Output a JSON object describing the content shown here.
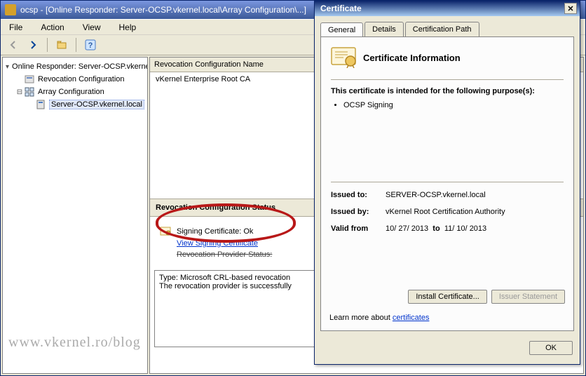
{
  "window": {
    "title": "ocsp - [Online Responder: Server-OCSP.vkernel.local\\Array Configuration\\...]"
  },
  "menubar": {
    "file": "File",
    "action": "Action",
    "view": "View",
    "help": "Help"
  },
  "tree": {
    "root": "Online Responder: Server-OCSP.vkernel",
    "revoc": "Revocation Configuration",
    "array": "Array Configuration",
    "server": "Server-OCSP.vkernel.local"
  },
  "detail": {
    "header": "Revocation Configuration Name",
    "row1": "vKernel Enterprise Root CA",
    "status_header": "Revocation Configuration Status",
    "signing_line": "Signing Certificate: Ok",
    "view_signing": "View Signing Certificate",
    "prov_line": "Revocation Provider Status:",
    "type_line1": "Type: Microsoft CRL-based revocation",
    "type_line2": "The revocation provider is successfully"
  },
  "certdlg": {
    "title": "Certificate",
    "tabs": {
      "general": "General",
      "details": "Details",
      "certpath": "Certification Path"
    },
    "heading": "Certificate Information",
    "purpose_intro": "This certificate is intended for the following purpose(s):",
    "purpose1": "OCSP Signing",
    "issued_to_label": "Issued to:",
    "issued_to": "SERVER-OCSP.vkernel.local",
    "issued_by_label": "Issued by:",
    "issued_by": "vKernel Root Certification Authority",
    "valid_from_label": "Valid from",
    "valid_from": "10/ 27/ 2013",
    "valid_to_word": "to",
    "valid_to": "11/ 10/ 2013",
    "install_btn": "Install Certificate...",
    "issuer_btn": "Issuer Statement",
    "learn_prefix": "Learn more about ",
    "learn_link": "certificates",
    "ok": "OK"
  },
  "watermark": "www.vkernel.ro/blog"
}
